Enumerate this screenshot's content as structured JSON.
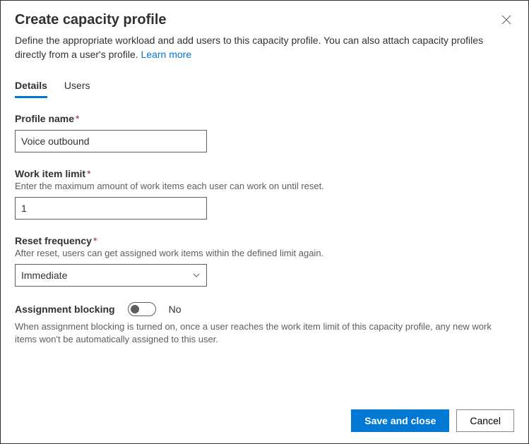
{
  "dialog": {
    "title": "Create capacity profile",
    "subtitle": "Define the appropriate workload and add users to this capacity profile. You can also attach capacity profiles directly from a user's profile. ",
    "learn_more": "Learn more"
  },
  "tabs": {
    "details": "Details",
    "users": "Users"
  },
  "fields": {
    "profile_name": {
      "label": "Profile name",
      "value": "Voice outbound"
    },
    "work_item_limit": {
      "label": "Work item limit",
      "help": "Enter the maximum amount of work items each user can work on until reset.",
      "value": "1"
    },
    "reset_frequency": {
      "label": "Reset frequency",
      "help": "After reset, users can get assigned work items within the defined limit again.",
      "value": "Immediate"
    },
    "assignment_blocking": {
      "label": "Assignment blocking",
      "state": "No",
      "help": "When assignment blocking is turned on, once a user reaches the work item limit of this capacity profile, any new work items won't be automatically assigned to this user."
    }
  },
  "footer": {
    "save": "Save and close",
    "cancel": "Cancel"
  }
}
